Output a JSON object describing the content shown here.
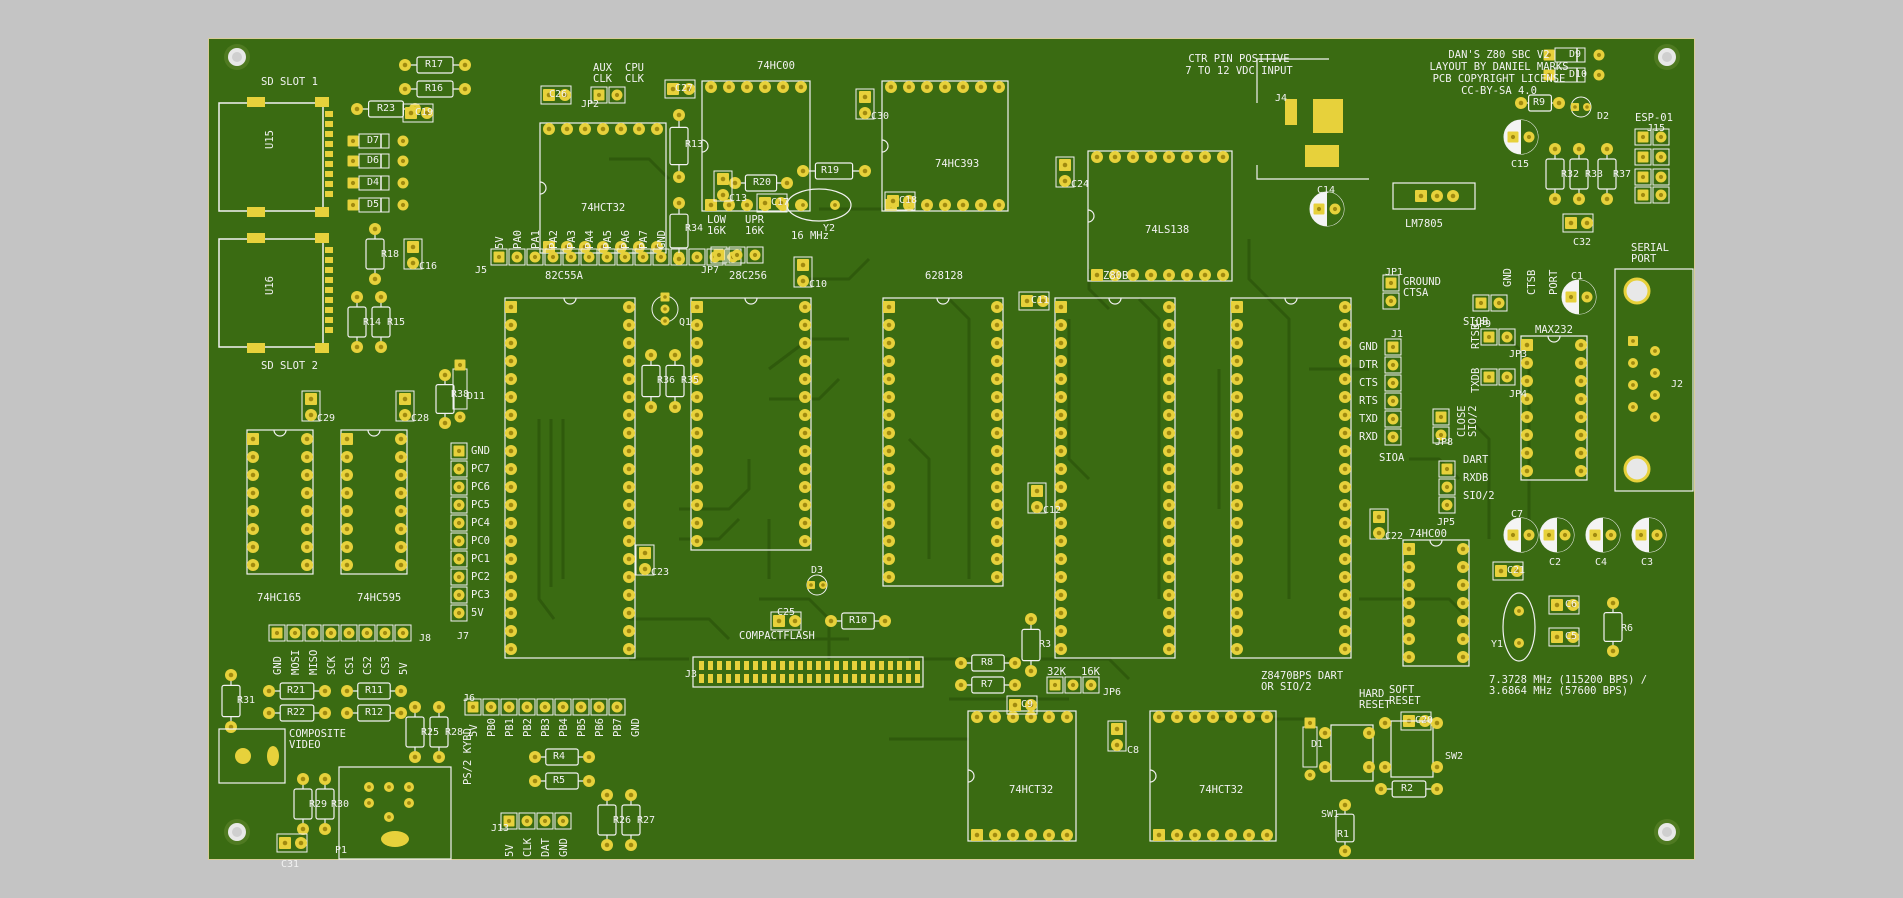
{
  "colors": {
    "background": "#c4c4c4",
    "board": "#3a6b12",
    "trace": "#2f5a0c",
    "pad": "#e7d13b",
    "silk": "#f2f2f2"
  },
  "title_block": {
    "lines": [
      "DAN'S Z80 SBC V2",
      "LAYOUT BY DANIEL MARKS",
      "PCB COPYRIGHT LICENSE",
      "CC-BY-SA 4.0"
    ]
  },
  "power_note": {
    "lines": [
      "CTR PIN POSITIVE",
      "7 TO 12 VDC INPUT"
    ]
  },
  "sd_slots": {
    "slot1": "SD SLOT 1",
    "slot2": "SD SLOT 2"
  },
  "ics": {
    "U1": "MAX232",
    "U2": "74LS138",
    "U3": "628128",
    "U4": "28C256",
    "U5": "LM7805",
    "U6": "74HCT32",
    "U7": "74HC00",
    "U8": "74HCT32",
    "U9": "82C55A",
    "U10": "74HCT32",
    "U11": "74HC00",
    "U12": "74HC393",
    "U13": "74HC595",
    "U14": "74HC165",
    "U15": "U15",
    "U16": "U16",
    "IC1": "Z8470BPS DART\nOR SIO/2",
    "IC2": "Z80B"
  },
  "crystals": {
    "y1": "7.3728 MHz (115200 BPS) /\n3.6864 MHz (57600 BPS)",
    "y2": "16 MHz"
  },
  "connectors": {
    "esp": "ESP-01",
    "serial": "SERIAL\nPORT",
    "composite": "COMPOSITE\nVIDEO",
    "ps2": "PS/2 KYBD",
    "compactflash": "COMPACTFLASH"
  },
  "jumpers": {
    "ground_ctsa": "GROUND\nCTSA",
    "low16k": "LOW\n16K",
    "upr16k": "UPR\n16K",
    "k32": "32K",
    "k16": "16K",
    "aux_clk": "AUX\nCLK",
    "cpu_clk": "CPU\nCLK",
    "close_sio2": "CLOSE\nSIO/2",
    "dart": "DART",
    "rxdb": "RXDB",
    "sio2": "SIO/2",
    "siob": "SIOB",
    "rtsb": "RTSB",
    "txdb": "TXDB",
    "ctsb": "CTSB",
    "port": "PORT",
    "gnd": "GND",
    "sioa": "SIOA"
  },
  "buttons": {
    "hard_reset": "HARD\nRESET",
    "soft_reset": "SOFT\nRESET"
  },
  "pin_labels": {
    "j1": [
      "GND",
      "DTR",
      "CTS",
      "RTS",
      "TXD",
      "RXD"
    ],
    "j7": [
      "GND",
      "PC7",
      "PC6",
      "PC5",
      "PC4",
      "PC0",
      "PC1",
      "PC2",
      "PC3",
      "5V"
    ],
    "j5": [
      "5V",
      "PA0",
      "PA1",
      "PA2",
      "PA3",
      "PA4",
      "PA5",
      "PA6",
      "PA7",
      "GND"
    ],
    "j6": [
      "5V",
      "PB0",
      "PB1",
      "PB2",
      "PB3",
      "PB4",
      "PB5",
      "PB6",
      "PB7",
      "GND"
    ],
    "j8": [
      "GND",
      "MOSI",
      "MISO",
      "SCK",
      "CS1",
      "CS2",
      "CS3",
      "5V"
    ],
    "j13": [
      "5V",
      "CLK",
      "DAT",
      "GND"
    ]
  },
  "refdes": {
    "resistors": [
      "R1",
      "R2",
      "R3",
      "R4",
      "R5",
      "R6",
      "R7",
      "R8",
      "R9",
      "R10",
      "R11",
      "R12",
      "R13",
      "R14",
      "R15",
      "R16",
      "R17",
      "R18",
      "R19",
      "R20",
      "R21",
      "R22",
      "R23",
      "R25",
      "R26",
      "R27",
      "R28",
      "R29",
      "R30",
      "R31",
      "R32",
      "R33",
      "R34",
      "R35",
      "R36",
      "R37",
      "R38"
    ],
    "capacitors": [
      "C1",
      "C2",
      "C3",
      "C4",
      "C5",
      "C6",
      "C7",
      "C8",
      "C9",
      "C10",
      "C11",
      "C12",
      "C13",
      "C14",
      "C15",
      "C16",
      "C17",
      "C18",
      "C19",
      "C20",
      "C21",
      "C22",
      "C23",
      "C24",
      "C25",
      "C26",
      "C27",
      "C28",
      "C29",
      "C30",
      "C31",
      "C32"
    ],
    "diodes": [
      "D1",
      "D2",
      "D3",
      "D4",
      "D5",
      "D6",
      "D7",
      "D9",
      "D10",
      "D11"
    ],
    "headers": [
      "J1",
      "J2",
      "J3",
      "J4",
      "J5",
      "J6",
      "J7",
      "J8",
      "J13",
      "J15",
      "JP1",
      "JP2",
      "JP3",
      "JP4",
      "JP5",
      "JP6",
      "JP7",
      "JP8",
      "JP9"
    ],
    "other": [
      "Q1",
      "Y1",
      "Y2",
      "SW1",
      "SW2",
      "P1"
    ]
  }
}
